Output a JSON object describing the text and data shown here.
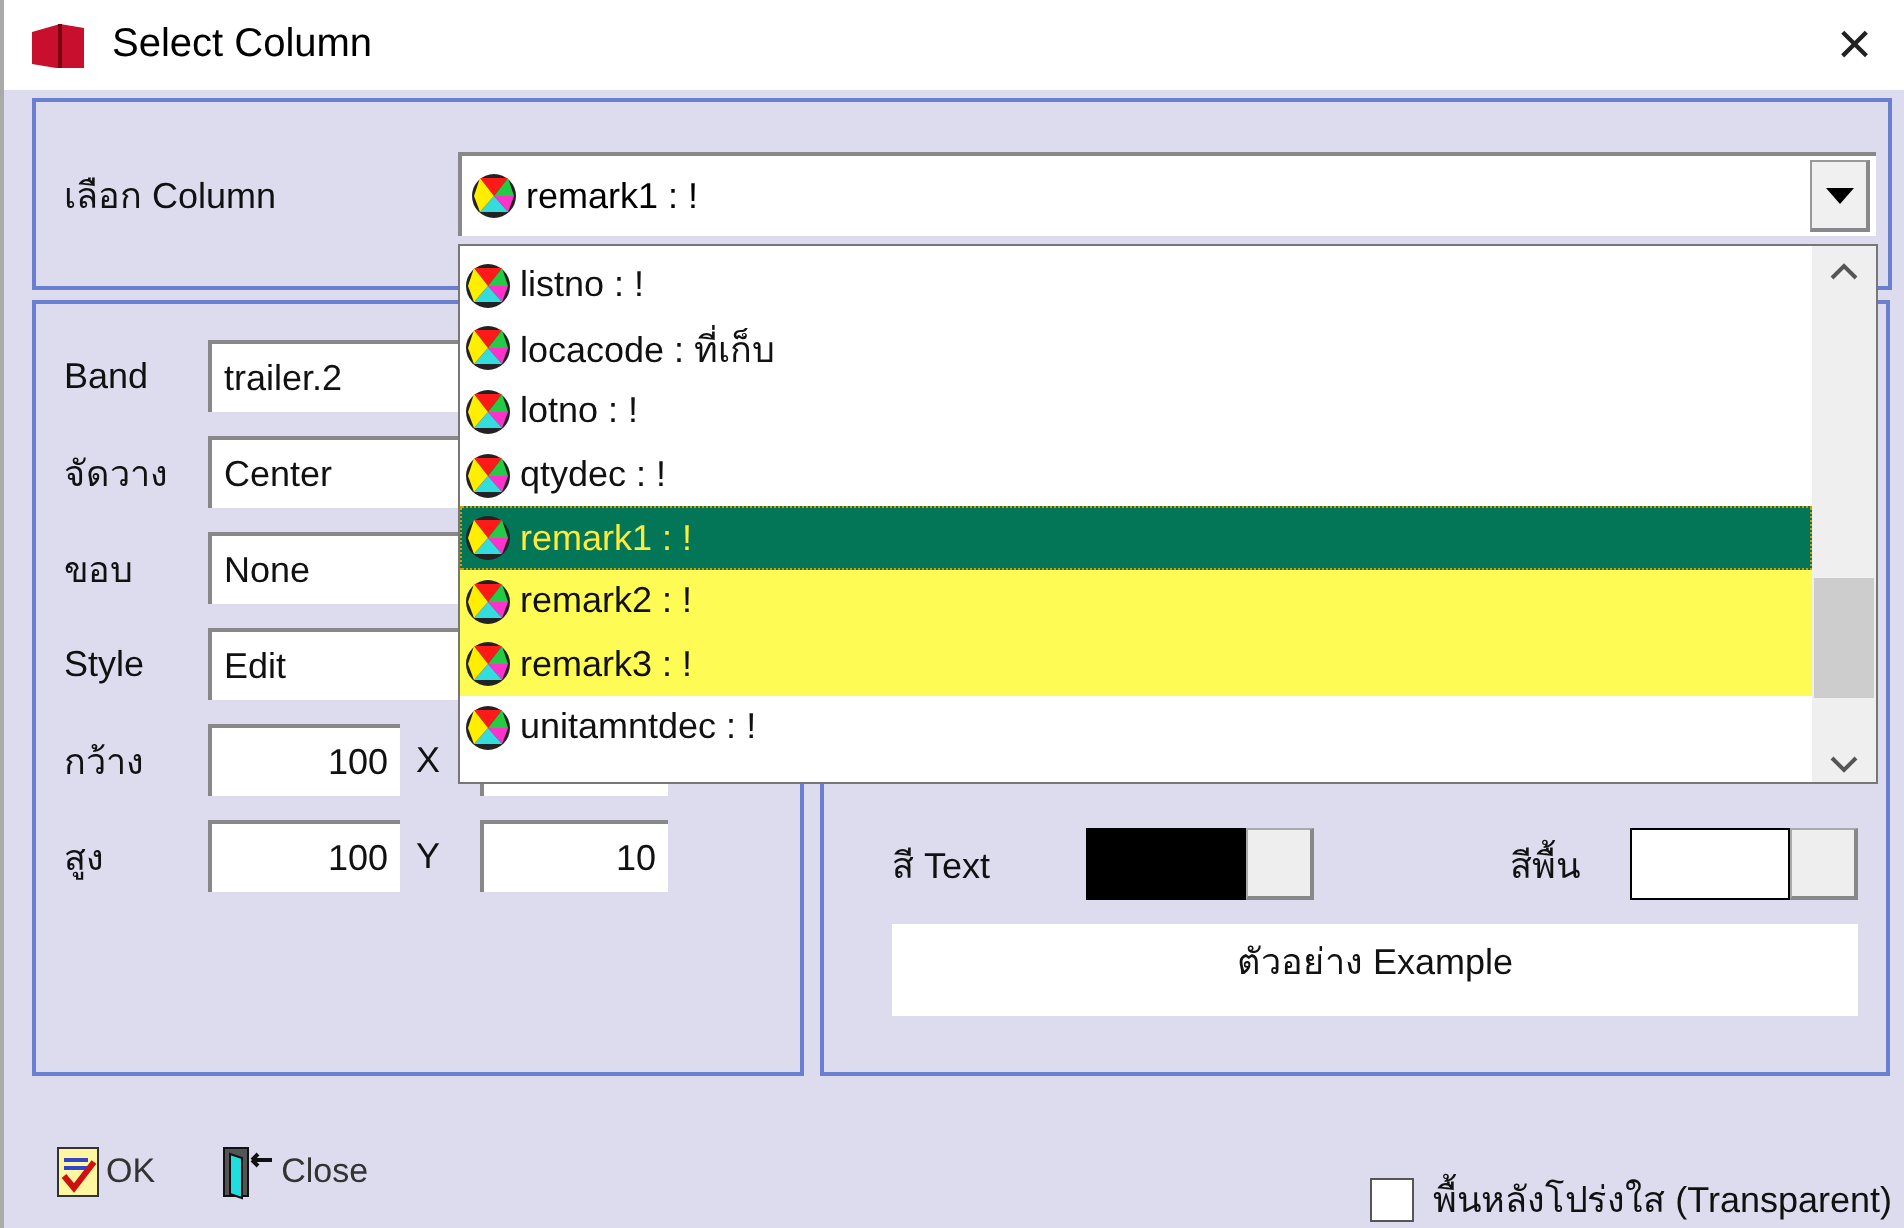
{
  "window": {
    "title": "Select Column",
    "close": "×"
  },
  "column_select": {
    "label": "เลือก Column",
    "value": "remark1 : !",
    "expanded": true,
    "options": [
      {
        "label": "listno : !",
        "selected": false,
        "marked": false
      },
      {
        "label": "locacode : ที่เก็บ",
        "selected": false,
        "marked": false
      },
      {
        "label": "lotno : !",
        "selected": false,
        "marked": false
      },
      {
        "label": "qtydec : !",
        "selected": false,
        "marked": false
      },
      {
        "label": "remark1 : !",
        "selected": true,
        "marked": false
      },
      {
        "label": "remark2 : !",
        "selected": false,
        "marked": true
      },
      {
        "label": "remark3 : !",
        "selected": false,
        "marked": true
      },
      {
        "label": "unitamntdec : !",
        "selected": false,
        "marked": false
      }
    ]
  },
  "properties": [
    {
      "label": "Band",
      "value": "trailer.2"
    },
    {
      "label": "จัดวาง",
      "value": "Center"
    },
    {
      "label": "ขอบ",
      "value": "None"
    },
    {
      "label": "Style",
      "value": "Edit"
    }
  ],
  "size": [
    {
      "label": "กว้าง",
      "value": "100",
      "pos_label": "X"
    },
    {
      "label": "สูง",
      "value": "100",
      "pos_label": "Y",
      "pos_value": "10"
    }
  ],
  "colors": [
    {
      "label": "สี Text",
      "color": "#000000"
    },
    {
      "label": "สีพื้น",
      "color": "#ffffff"
    }
  ],
  "example": "ตัวอย่าง Example",
  "buttons": [
    {
      "label": "OK",
      "kind": "ok"
    },
    {
      "label": "Close",
      "kind": "close"
    }
  ],
  "transparent": {
    "label": "พื้นหลังโปร่งใส (Transparent)",
    "checked": false
  }
}
